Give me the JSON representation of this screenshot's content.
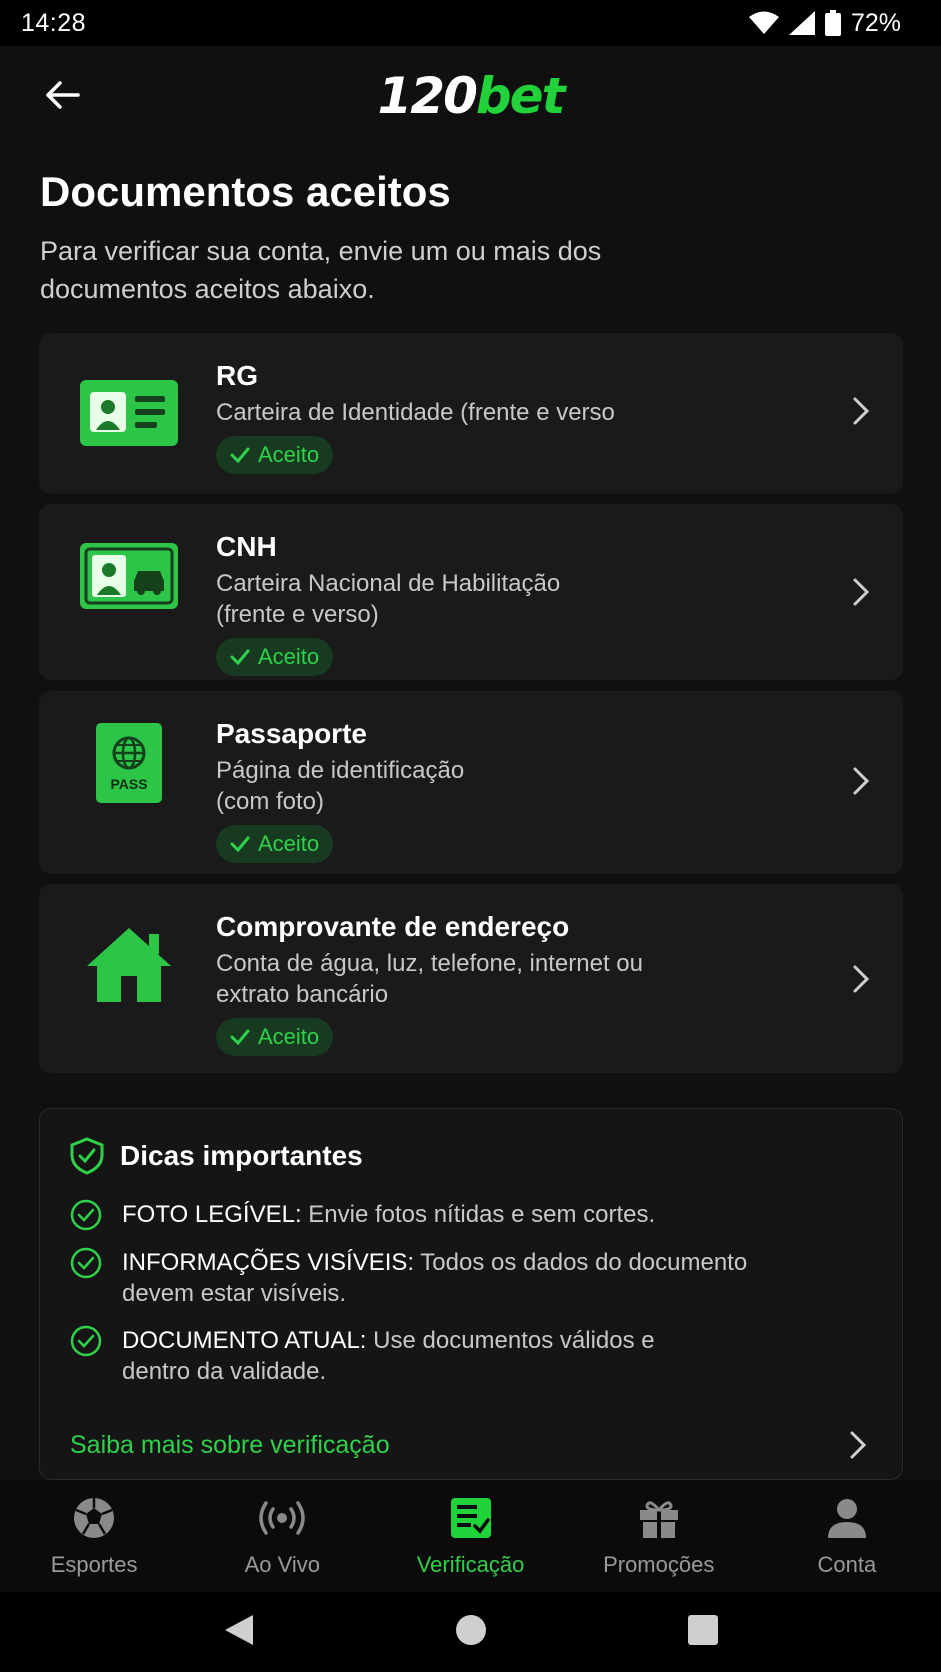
{
  "status_bar": {
    "time": "14:28",
    "battery": "72%"
  },
  "header": {
    "logo_number": "120",
    "logo_brand": "bet"
  },
  "intro": {
    "title": "Documentos aceitos",
    "subtitle": "Para verificar sua conta, envie um ou mais dos documentos aceitos abaixo."
  },
  "documents": [
    {
      "title": "RG",
      "description": "Carteira de Identidade (frente e verso",
      "badge": "Aceito",
      "icon": "id-card-icon"
    },
    {
      "title": "CNH",
      "description": "Carteira Nacional de Habilitação (frente e verso)",
      "badge": "Aceito",
      "icon": "driver-license-icon"
    },
    {
      "title": "Passaporte",
      "description": "Página de identificação (com foto)",
      "badge": "Aceito",
      "icon": "passport-icon",
      "icon_text": "PASS"
    },
    {
      "title": "Comprovante de endereço",
      "description": "Conta de água, luz, telefone, internet ou extrato bancário",
      "badge": "Aceito",
      "icon": "house-icon"
    }
  ],
  "tips": {
    "title": "Dicas importantes",
    "items": [
      {
        "label": "FOTO LEGÍVEL:",
        "text": "Envie fotos nítidas e sem cortes."
      },
      {
        "label": "INFORMAÇÕES VISÍVEIS:",
        "text": "Todos os dados do documento devem estar visíveis."
      },
      {
        "label": "DOCUMENTO ATUAL:",
        "text": "Use documentos válidos e dentro da validade."
      }
    ],
    "link": "Saiba mais sobre verificação"
  },
  "bottom_nav": [
    {
      "label": "Esportes",
      "icon": "soccer-ball-icon",
      "active": false
    },
    {
      "label": "Ao Vivo",
      "icon": "live-broadcast-icon",
      "active": false
    },
    {
      "label": "Verificação",
      "icon": "verification-document-icon",
      "active": true
    },
    {
      "label": "Promoções",
      "icon": "gift-icon",
      "active": false
    },
    {
      "label": "Conta",
      "icon": "user-icon",
      "active": false
    }
  ],
  "colors": {
    "accent": "#22d23a",
    "background": "#101010",
    "card": "#1a1a1a"
  }
}
